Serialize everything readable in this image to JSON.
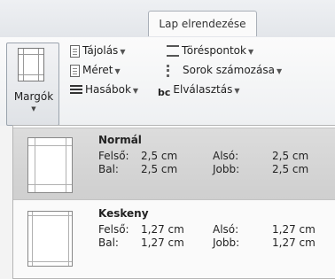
{
  "ribbon": {
    "active_tab": "Lap elrendezése",
    "margins_button": {
      "label": "Margók"
    },
    "buttons": {
      "orientation": "Tájolás",
      "size": "Méret",
      "columns": "Hasábok",
      "breaks": "Töréspontok",
      "line_numbers": "Sorok számozása",
      "hyphenation": "Elválasztás"
    },
    "hyphenation_icon_text": "bc"
  },
  "dropdown": {
    "options": [
      {
        "name": "Normál",
        "top_label": "Felső:",
        "top": "2,5 cm",
        "bottom_label": "Alsó:",
        "bottom": "2,5 cm",
        "left_label": "Bal:",
        "left": "2,5 cm",
        "right_label": "Jobb:",
        "right": "2,5 cm",
        "selected": true
      },
      {
        "name": "Keskeny",
        "top_label": "Felső:",
        "top": "1,27 cm",
        "bottom_label": "Alsó:",
        "bottom": "1,27 cm",
        "left_label": "Bal:",
        "left": "1,27 cm",
        "right_label": "Jobb:",
        "right": "1,27 cm",
        "selected": false
      }
    ]
  }
}
